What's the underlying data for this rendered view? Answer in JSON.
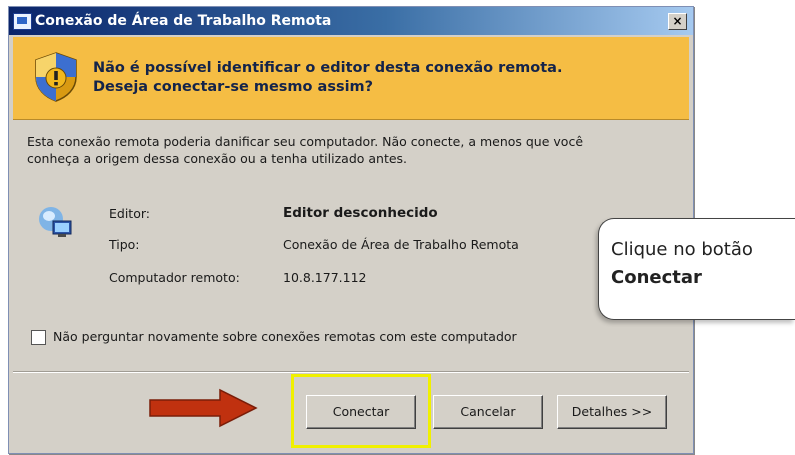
{
  "window": {
    "title": "Conexão de Área de Trabalho Remota",
    "close_label": "×"
  },
  "warning": {
    "icon": "shield-warning-icon",
    "line1": "Não é possível identificar o editor desta conexão remota.",
    "line2": "Deseja conectar-se mesmo assim?",
    "background_color": "#f5bd44"
  },
  "description": {
    "line1": "Esta conexão remota poderia danificar seu computador. Não conecte, a menos que você",
    "line2": "conheça a origem dessa conexão ou a tenha utilizado antes."
  },
  "details": {
    "icon": "network-computer-icon",
    "rows": [
      {
        "label": "Editor:",
        "value": "Editor desconhecido"
      },
      {
        "label": "Tipo:",
        "value": "Conexão de Área de Trabalho Remota"
      },
      {
        "label": "Computador remoto:",
        "value": "10.8.177.112"
      }
    ]
  },
  "checkbox": {
    "label": "Não perguntar novamente sobre conexões remotas com este computador",
    "checked": false
  },
  "buttons": {
    "connect": "Conectar",
    "cancel": "Cancelar",
    "details": "Detalhes >>"
  },
  "annotation": {
    "callout_line1": "Clique no botão",
    "callout_line2": "Conectar",
    "highlight_color": "#f0f000",
    "arrow_color": "#c0310f"
  }
}
